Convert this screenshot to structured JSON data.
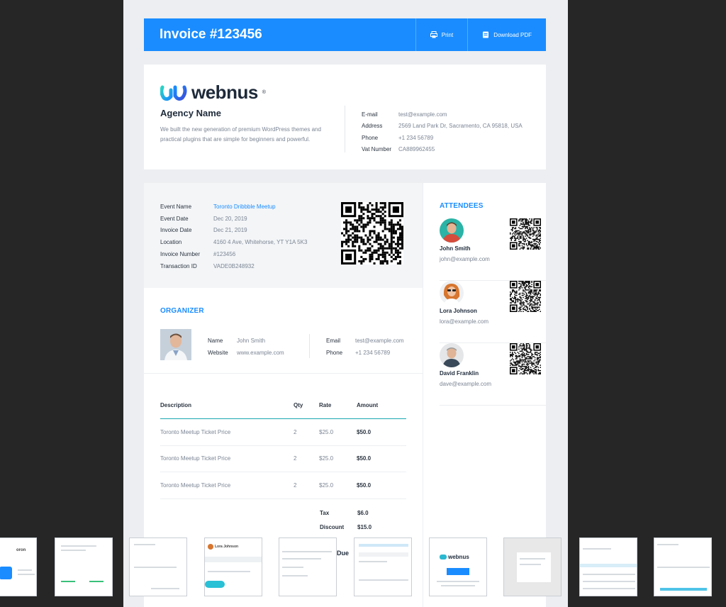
{
  "header": {
    "title": "Invoice #123456",
    "print_label": "Print",
    "download_label": "Download PDF"
  },
  "agency": {
    "logo_text": "webnus",
    "logo_reg": "®",
    "name": "Agency Name",
    "description": "We built the new generation of premium WordPress themes and practical plugins that are simple for beginners and powerful.",
    "details": [
      {
        "label": "E-mail",
        "value": "test@example.com"
      },
      {
        "label": "Address",
        "value": "2569 Land Park Dr, Sacramento, CA 95818, USA"
      },
      {
        "label": "Phone",
        "value": "+1 234 56789"
      },
      {
        "label": "Vat Number",
        "value": "CA889962455"
      }
    ]
  },
  "event": {
    "rows": [
      {
        "label": "Event Name",
        "value": "Toronto Dribbble Meetup"
      },
      {
        "label": "Event Date",
        "value": "Dec 20, 2019"
      },
      {
        "label": "Invoice Date",
        "value": "Dec 21, 2019"
      },
      {
        "label": "Location",
        "value": "4160 4 Ave, Whitehorse, YT Y1A 5K3"
      },
      {
        "label": "Invoice Number",
        "value": "#123456"
      },
      {
        "label": "Transaction ID",
        "value": "VADE0B248932"
      }
    ]
  },
  "organizer": {
    "title": "ORGANIZER",
    "name_label": "Name",
    "name": "John Smith",
    "website_label": "Website",
    "website": "www.example.com",
    "email_label": "Email",
    "email": "test@example.com",
    "phone_label": "Phone",
    "phone": "+1 234 56789"
  },
  "table": {
    "headers": [
      "Description",
      "Qty",
      "Rate",
      "Amount"
    ],
    "rows": [
      [
        "Toronto Meetup Ticket Price",
        "2",
        "$25.0",
        "$50.0"
      ],
      [
        "Toronto Meetup Ticket Price",
        "2",
        "$25.0",
        "$50.0"
      ],
      [
        "Toronto Meetup Ticket Price",
        "2",
        "$25.0",
        "$50.0"
      ]
    ],
    "summary": [
      {
        "label": "Tax",
        "value": "$6.0"
      },
      {
        "label": "Discount",
        "value": "$15.0"
      }
    ],
    "due_label": "Due"
  },
  "attendees": {
    "title": "ATTENDEES",
    "list": [
      {
        "name": "John Smith",
        "email": "john@example.com"
      },
      {
        "name": "Lora Johnson",
        "email": "lora@example.com"
      },
      {
        "name": "David Franklin",
        "email": "dave@example.com"
      }
    ]
  },
  "thumbnails": {
    "t1_text": "oron",
    "t4_name": "Lora Johnson",
    "t7_logo": "webnus"
  },
  "colors": {
    "accent": "#1a8cff",
    "teal": "#1aa7b0",
    "background": "#262626"
  }
}
